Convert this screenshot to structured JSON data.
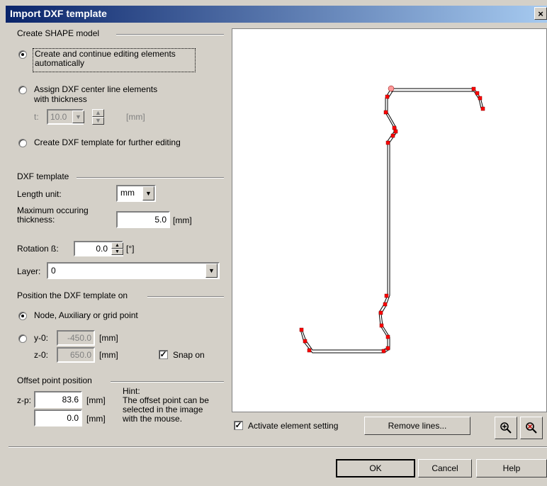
{
  "window": {
    "title": "Import DXF template",
    "close": "×"
  },
  "create_shape": {
    "group_label": "Create SHAPE model",
    "opt1_line1": "Create and continue editing elements",
    "opt1_line2": "automatically",
    "opt2_line1": "Assign DXF center line elements",
    "opt2_line2": "with thickness",
    "t_label": "t:",
    "t_value": "10.0",
    "t_unit": "[mm]",
    "opt3": "Create DXF template for further editing"
  },
  "dxf_template": {
    "group_label": "DXF template",
    "length_unit_label": "Length unit:",
    "length_unit_value": "mm",
    "max_thick_line1": "Maximum occuring",
    "max_thick_line2": "thickness:",
    "max_thick_value": "5.0",
    "max_thick_unit": "[mm]",
    "rotation_label": "Rotation ß:",
    "rotation_value": "0.0",
    "rotation_unit": "[°]",
    "layer_label": "Layer:",
    "layer_value": "0"
  },
  "position": {
    "group_label": "Position the DXF template on",
    "opt1": "Node, Auxiliary or grid point",
    "y0_label": "y-0:",
    "y0_value": "-450.0",
    "y0_unit": "[mm]",
    "z0_label": "z-0:",
    "z0_value": "650.0",
    "z0_unit": "[mm]",
    "snap_label": "Snap on"
  },
  "offset": {
    "group_label": "Offset point position",
    "zp_label": "z-p:",
    "zp_value": "83.6",
    "zp_unit": "[mm]",
    "v2_value": "0.0",
    "v2_unit": "[mm]",
    "hint1": "Hint:",
    "hint2": "The offset point can be",
    "hint3": "selected in the image",
    "hint4": "with the mouse."
  },
  "preview": {
    "activate_label": "Activate element setting",
    "remove_lines": "Remove lines..."
  },
  "buttons": {
    "ok": "OK",
    "cancel": "Cancel",
    "help": "Help"
  },
  "colors": {
    "title_start": "#0a246a",
    "title_end": "#a6caf0",
    "node": "#ff0000"
  }
}
